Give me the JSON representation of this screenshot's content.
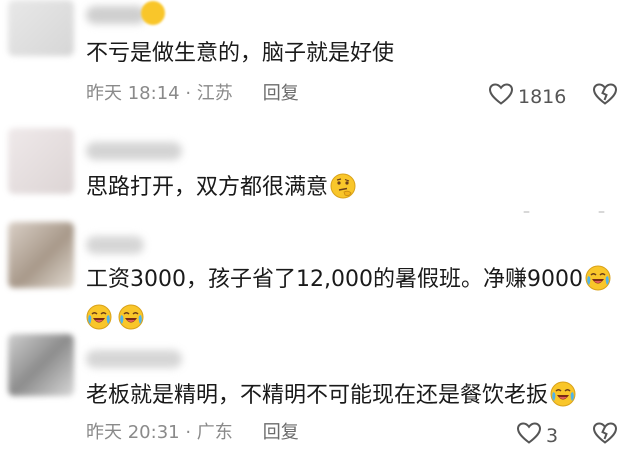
{
  "comments": [
    {
      "text": "不亏是做生意的，脑子就是好使",
      "time": "昨天 18:14",
      "location": "江苏",
      "reply_label": "回复",
      "likes": "1816"
    },
    {
      "text": "思路打开，双方都很满意"
    },
    {
      "text": "工资3000，孩子省了12,000的暑假班。净赚9000"
    },
    {
      "text": "老板就是精明，不精明不可能现在还是餐饮老扳",
      "time": "昨天 20:31",
      "location": "广东",
      "reply_label": "回复",
      "likes": "3"
    }
  ],
  "colors": {
    "text": "#1a1a1a",
    "meta": "#8a8a8a",
    "emoji_face": "#f9c62a"
  },
  "icons": {
    "like": "heart-outline-icon",
    "dislike": "broken-heart-icon",
    "emoji_thinking": "thinking-face-emoji-icon",
    "emoji_crying": "crying-laughing-emoji-icon"
  }
}
